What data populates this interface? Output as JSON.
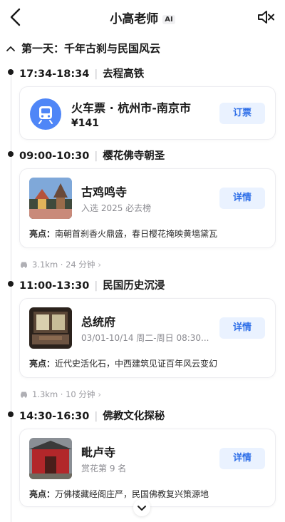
{
  "header": {
    "title": "小高老师",
    "ai_badge": "AI",
    "back_icon": "chevron-left-icon",
    "mute_icon": "speaker-muted-icon"
  },
  "day": {
    "label": "第一天：千年古刹与民国风云"
  },
  "segments": [
    {
      "time": "17:34-18:34",
      "activity": "去程高铁",
      "card": {
        "type": "train",
        "title": "火车票 · 杭州市-南京市",
        "price": "¥141",
        "button": "订票"
      }
    },
    {
      "time": "09:00-10:30",
      "activity": "樱花佛寺朝圣",
      "card": {
        "type": "poi",
        "title": "古鸡鸣寺",
        "subtitle": "入选 2025 必去榜",
        "highlight_label": "亮点：",
        "highlight": "南朝首刹香火鼎盛，春日樱花掩映黄墙黛瓦",
        "button": "详情"
      },
      "distance": "3.1km · 24 分钟"
    },
    {
      "time": "11:00-13:30",
      "activity": "民国历史沉浸",
      "card": {
        "type": "poi",
        "title": "总统府",
        "subtitle": "03/01-10/14 周二-周日 08:30...",
        "highlight_label": "亮点：",
        "highlight": "近代史活化石，中西建筑见证百年风云变幻",
        "button": "详情"
      },
      "distance": "1.3km · 10 分钟"
    },
    {
      "time": "14:30-16:30",
      "activity": "佛教文化探秘",
      "card": {
        "type": "poi",
        "title": "毗卢寺",
        "subtitle": "赏花第 9 名",
        "highlight_label": "亮点：",
        "highlight": "万佛楼藏经阁庄严，民国佛教复兴策源地",
        "button": "详情"
      }
    }
  ],
  "colors": {
    "accent": "#2f6fe8",
    "button_bg": "#eaf2ff",
    "train_icon_bg": "#4f86f7"
  }
}
